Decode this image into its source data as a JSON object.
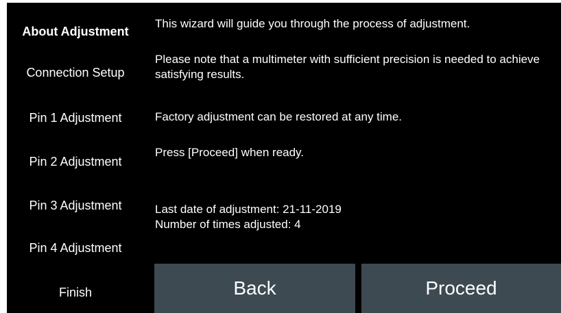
{
  "sidebar": {
    "items": [
      {
        "label": "About Adjustment",
        "selected": true
      },
      {
        "label": "Connection Setup",
        "selected": false
      },
      {
        "label": "Pin 1 Adjustment",
        "selected": false
      },
      {
        "label": "Pin 2 Adjustment",
        "selected": false
      },
      {
        "label": "Pin 3 Adjustment",
        "selected": false
      },
      {
        "label": "Pin 4 Adjustment",
        "selected": false
      },
      {
        "label": "Finish",
        "selected": false
      }
    ]
  },
  "content": {
    "intro": "This wizard will guide you through the process of adjustment.",
    "multimeter_note": "Please note that a multimeter with sufficient precision is needed to achieve satisfying results.",
    "restore_note": "Factory adjustment can be restored at any time.",
    "proceed_hint": "Press [Proceed] when ready.",
    "last_date": "Last date of adjustment: 21-11-2019",
    "times_adjusted": "Number of times adjusted: 4"
  },
  "buttons": {
    "back_label": "Back",
    "proceed_label": "Proceed"
  },
  "colors": {
    "background": "#000000",
    "button": "#3e4a52",
    "text": "#ffffff"
  }
}
